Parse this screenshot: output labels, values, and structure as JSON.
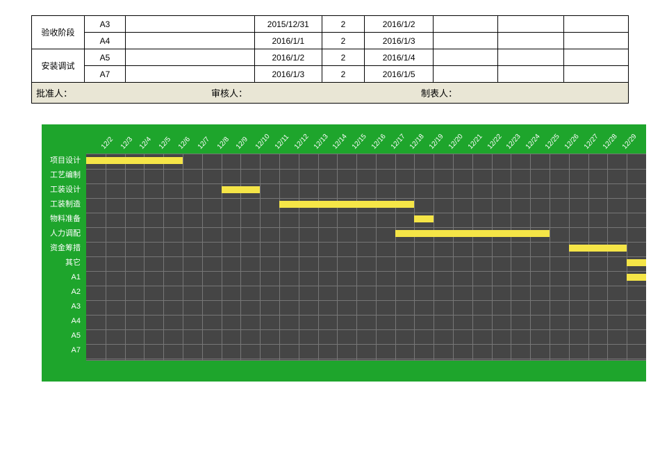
{
  "table": {
    "groups": [
      {
        "label": "验收阶段",
        "rows": [
          {
            "cells": [
              "A3",
              "",
              "2015/12/31",
              "2",
              "2016/1/2",
              "",
              "",
              ""
            ]
          },
          {
            "cells": [
              "A4",
              "",
              "2016/1/1",
              "2",
              "2016/1/3",
              "",
              "",
              ""
            ]
          }
        ]
      },
      {
        "label": "安装调试",
        "rows": [
          {
            "cells": [
              "A5",
              "",
              "2016/1/2",
              "2",
              "2016/1/4",
              "",
              "",
              ""
            ]
          },
          {
            "cells": [
              "A7",
              "",
              "2016/1/3",
              "2",
              "2016/1/5",
              "",
              "",
              ""
            ]
          }
        ]
      }
    ]
  },
  "footer": {
    "approve": "批准人：",
    "review": "审核人：",
    "prepare": "制表人："
  },
  "chart_data": {
    "type": "bar",
    "title": "",
    "xlabel": "",
    "ylabel": "",
    "x_start": "2015/12/1",
    "categories": [
      "12/2",
      "12/3",
      "12/4",
      "12/5",
      "12/6",
      "12/7",
      "12/8",
      "12/9",
      "12/10",
      "12/11",
      "12/12",
      "12/13",
      "12/14",
      "12/15",
      "12/16",
      "12/17",
      "12/18",
      "12/19",
      "12/20",
      "12/21",
      "12/22",
      "12/23",
      "12/24",
      "12/25",
      "12/26",
      "12/27",
      "12/28",
      "12/29"
    ],
    "series": [
      {
        "name": "项目设计",
        "start": 0,
        "duration": 5
      },
      {
        "name": "工艺编制",
        "start": 0,
        "duration": 0
      },
      {
        "name": "工装设计",
        "start": 7,
        "duration": 2
      },
      {
        "name": "工装制造",
        "start": 10,
        "duration": 7
      },
      {
        "name": "物料准备",
        "start": 17,
        "duration": 1
      },
      {
        "name": "人力调配",
        "start": 16,
        "duration": 8
      },
      {
        "name": "资金筹措",
        "start": 25,
        "duration": 3
      },
      {
        "name": "其它",
        "start": 28,
        "duration": 2
      },
      {
        "name": "A1",
        "start": 28,
        "duration": 2
      },
      {
        "name": "A2",
        "start": 0,
        "duration": 0
      },
      {
        "name": "A3",
        "start": 0,
        "duration": 0
      },
      {
        "name": "A4",
        "start": 0,
        "duration": 0
      },
      {
        "name": "A5",
        "start": 0,
        "duration": 0
      },
      {
        "name": "A7",
        "start": 0,
        "duration": 0
      }
    ]
  }
}
